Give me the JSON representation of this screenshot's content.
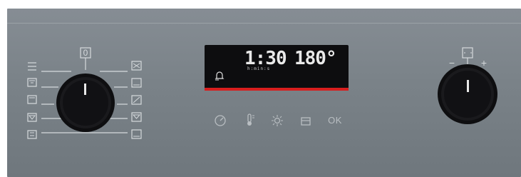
{
  "left_knob": {
    "top_label": "0"
  },
  "display": {
    "time": "1:30",
    "time_units": "h:min:s",
    "temperature": "180°"
  },
  "touch_bar": {
    "timer_icon": "timer-icon",
    "thermometer_icon": "thermometer-icon",
    "light_icon": "light-icon",
    "lock_icon": "childlock-icon",
    "ok_label": "OK"
  },
  "right_knob": {
    "minus_label": "−",
    "plus_label": "+"
  },
  "colors": {
    "panel": "#7b8389",
    "display_bg": "#0d0d0f",
    "display_accent": "#d81e1e",
    "knob": "#111111"
  }
}
